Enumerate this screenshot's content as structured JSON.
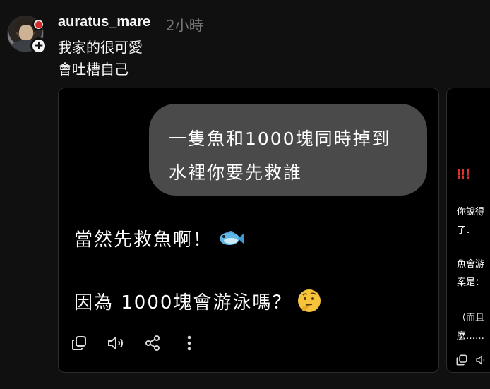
{
  "post": {
    "username": "auratus_mare",
    "timestamp": "2小時",
    "text_line1": "我家的很可愛",
    "text_line2": "會吐槽自己"
  },
  "card1": {
    "bubble_line1": "一隻魚和1000塊同時掉到",
    "bubble_line2": "水裡你要先救誰",
    "answer_line1": "當然先救魚啊！",
    "answer_line2": "因為 1000塊會游泳嗎？",
    "answer_line1_emoji": "fish-icon",
    "answer_line2_emoji": "thinking-face-icon"
  },
  "card2": {
    "exclaim": "‼！",
    "line1": "你說得",
    "line2": "了．",
    "line3": "魚會游",
    "line4": "案是：",
    "line5": "（而且",
    "line6": "麼……"
  },
  "icons": {
    "copy": "copy-icon",
    "speaker": "speaker-icon",
    "share": "share-icon",
    "more": "more-vertical-icon"
  },
  "colors": {
    "background": "#101010",
    "card_background": "#000000",
    "bubble": "#4a4a4a",
    "muted_text": "#777777",
    "alert_red": "#e0332f"
  }
}
